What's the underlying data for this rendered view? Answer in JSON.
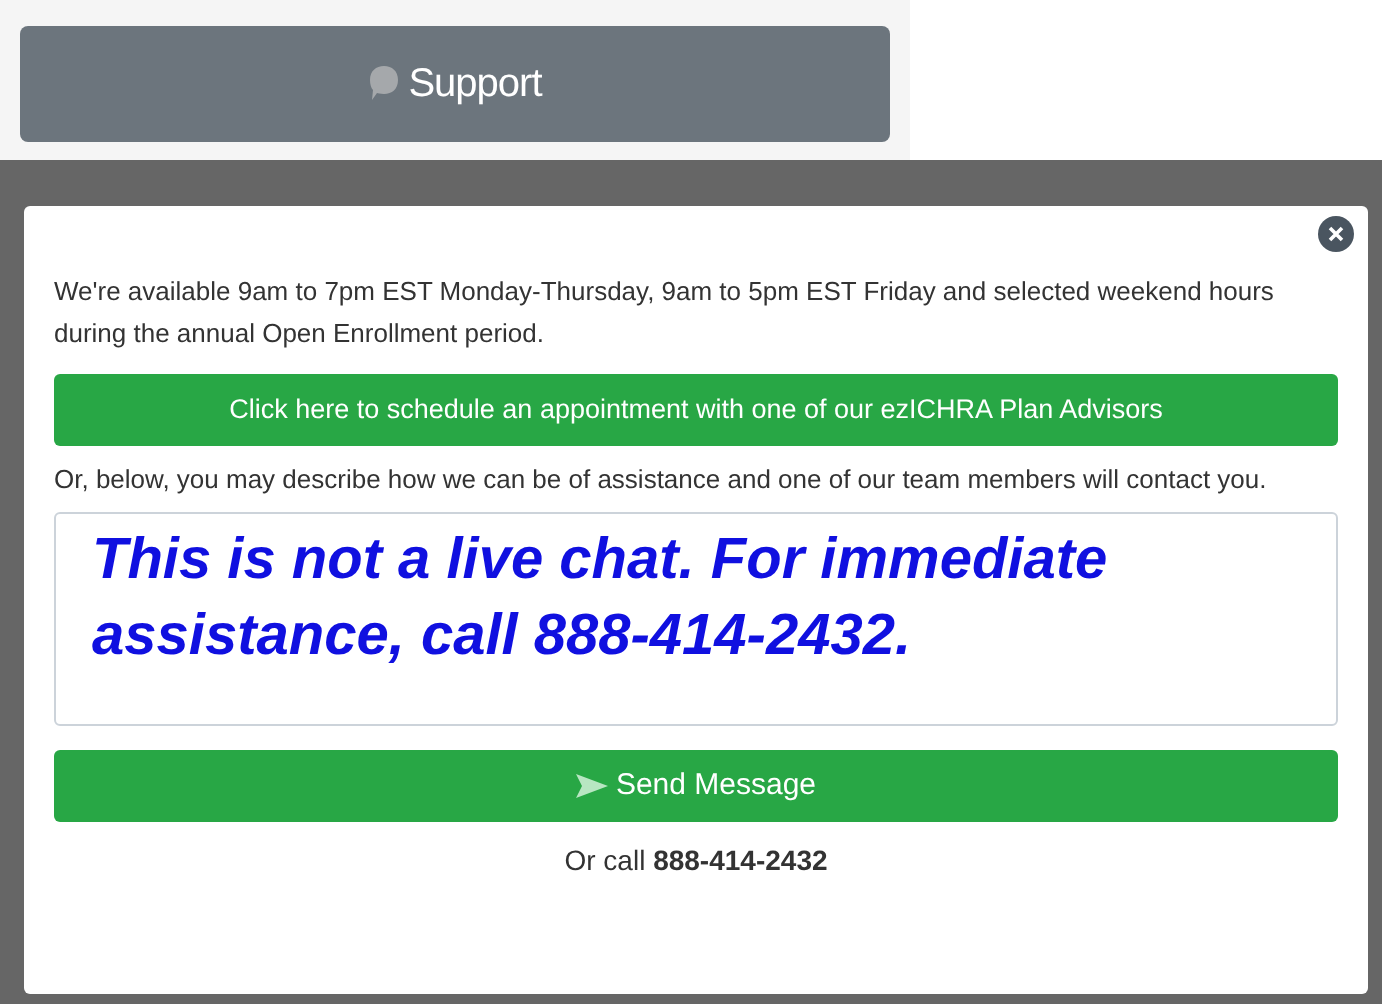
{
  "support_button": {
    "label": "Support"
  },
  "dialog": {
    "intro": "We're available 9am to 7pm EST Monday-Thursday, 9am to 5pm EST Friday and selected weekend hours during the annual Open Enrollment period.",
    "schedule_button": "Click here to schedule an appointment with one of our ezICHRA Plan Advisors",
    "description": "Or, below, you may describe how we can be of assistance and one of our team members will contact you.",
    "message": {
      "value": "This is not a live chat. For immediate assistance, call 888-414-2432."
    },
    "send_button": "Send Message",
    "footer": "Or call **888-414-2432**"
  }
}
